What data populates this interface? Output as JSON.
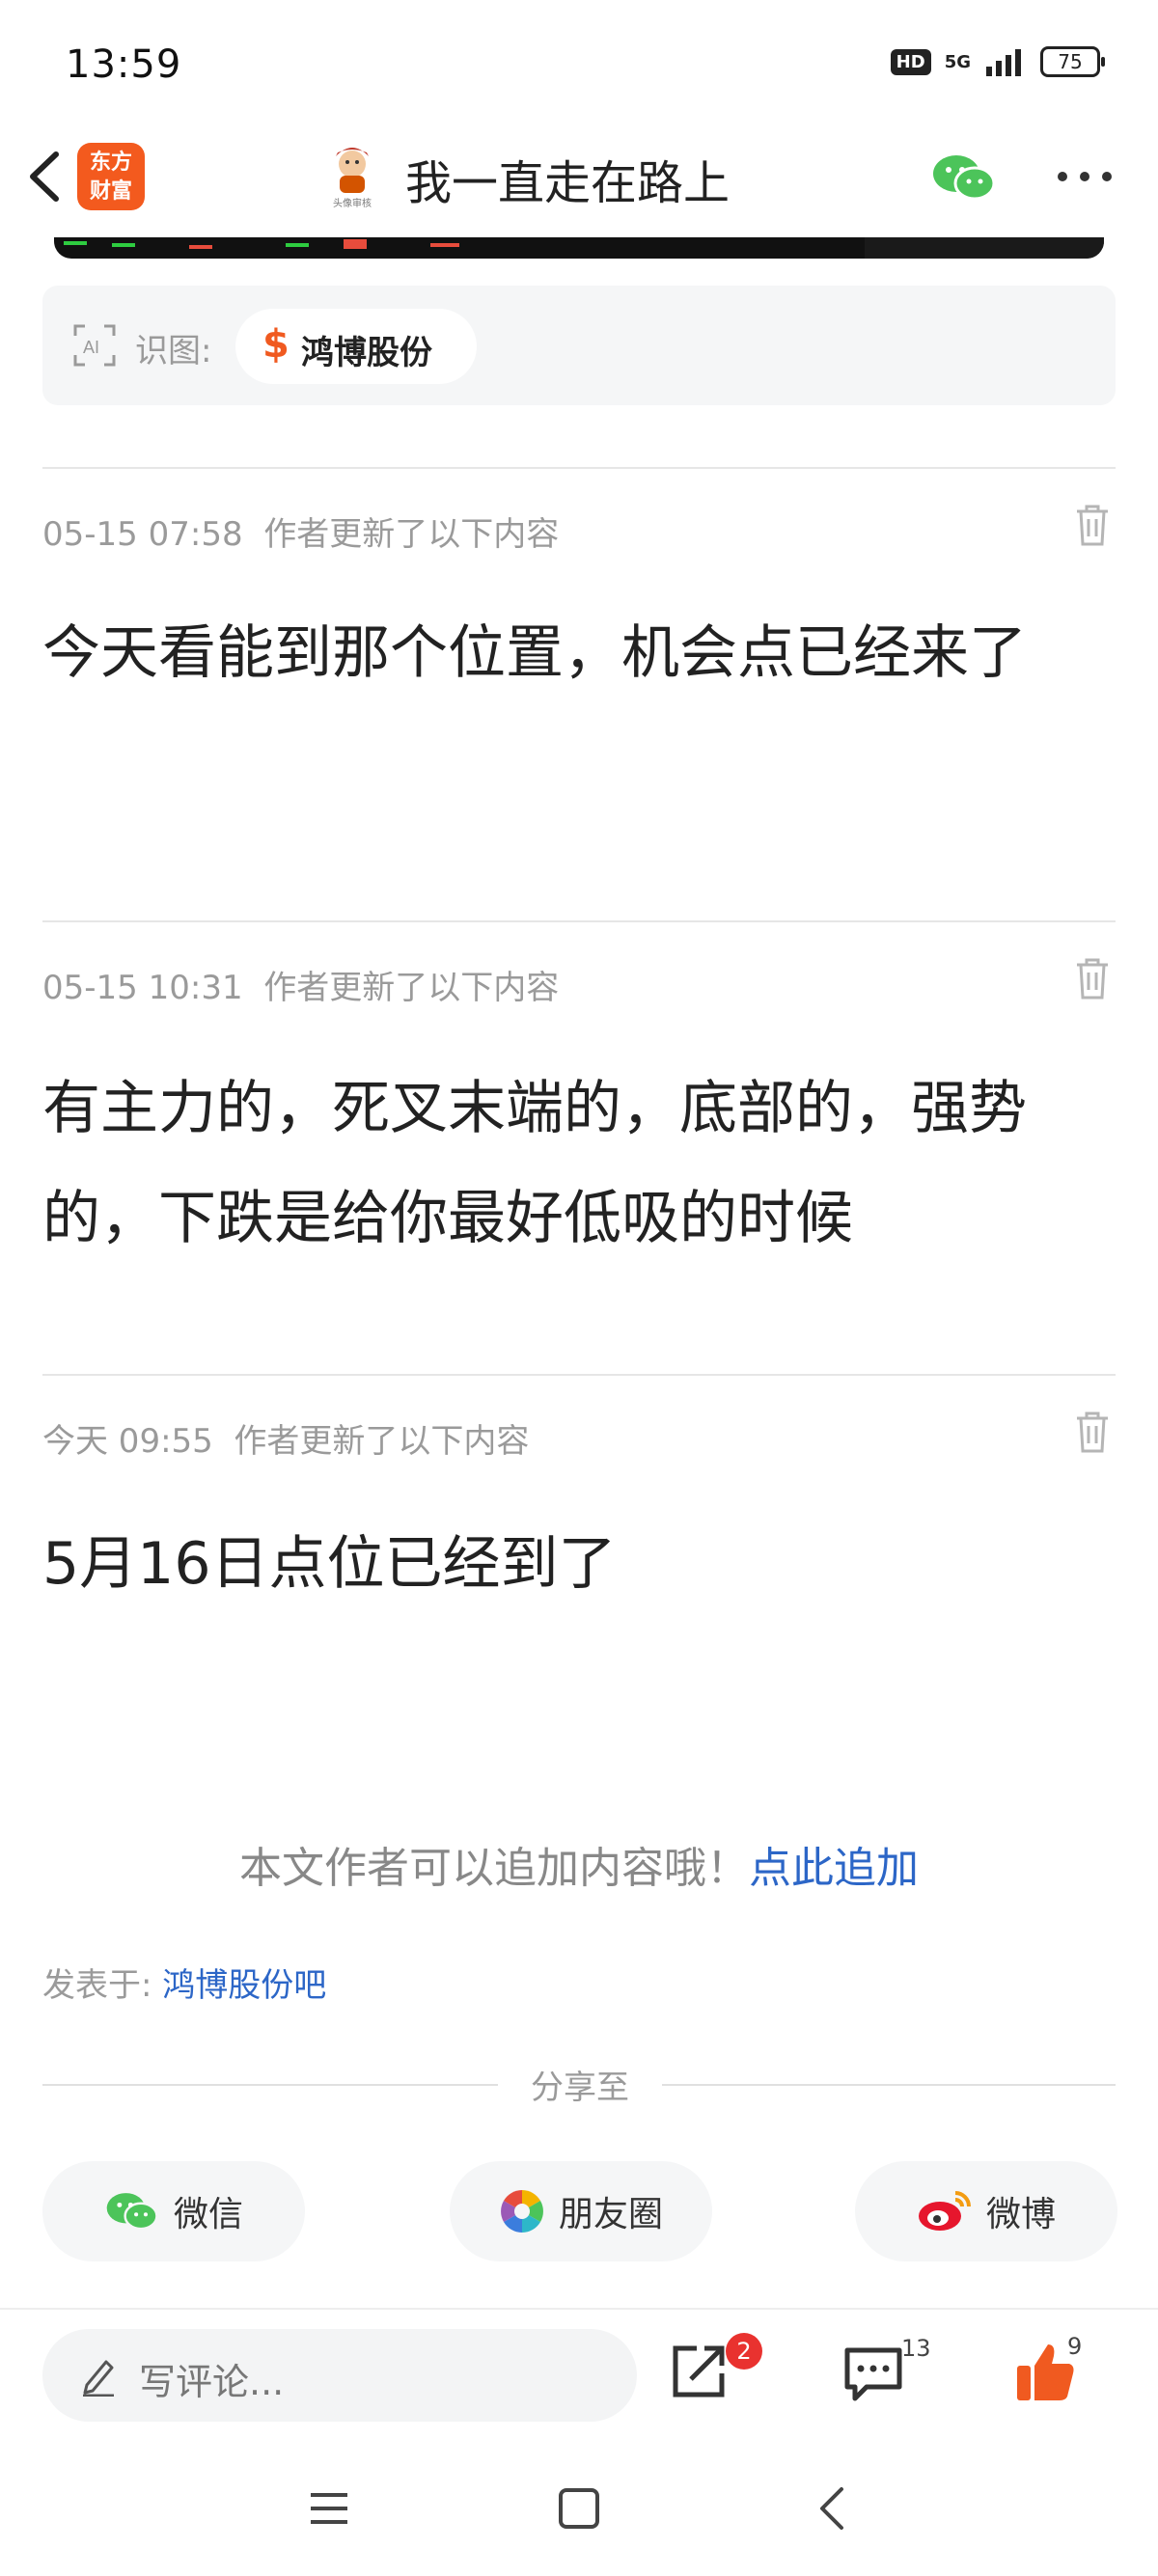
{
  "status_bar": {
    "time": "13:59",
    "hd": "HD",
    "network": "5G",
    "battery": "75"
  },
  "header": {
    "brand_logo_line1": "东方",
    "brand_logo_line2": "财富",
    "title": "我一直走在路上",
    "avatar_caption": "头像审核"
  },
  "ai_recognition": {
    "label": "识图:",
    "stock_icon": "$",
    "stock_name": "鸿博股份"
  },
  "updates": [
    {
      "time": "05-15 07:58",
      "note": "作者更新了以下内容",
      "text": "今天看能到那个位置，机会点已经来了"
    },
    {
      "time": "05-15 10:31",
      "note": "作者更新了以下内容",
      "text": "有主力的，死叉末端的，底部的，强势的，下跌是给你最好低吸的时候"
    },
    {
      "time": "今天 09:55",
      "note": "作者更新了以下内容",
      "text": "5月16日点位已经到了"
    }
  ],
  "append": {
    "prompt": "本文作者可以追加内容哦！",
    "link": "点此追加"
  },
  "posted_in": {
    "label": "发表于:",
    "link": "鸿博股份吧"
  },
  "share": {
    "title": "分享至",
    "wechat": "微信",
    "moments": "朋友圈",
    "weibo": "微博"
  },
  "bottom_bar": {
    "comment_placeholder": "写评论...",
    "forward_badge": "2",
    "comment_count": "13",
    "like_count": "9"
  },
  "colors": {
    "brand": "#f35a1e",
    "link": "#2c66c7",
    "like": "#f05a20",
    "badge": "#e9322f"
  }
}
